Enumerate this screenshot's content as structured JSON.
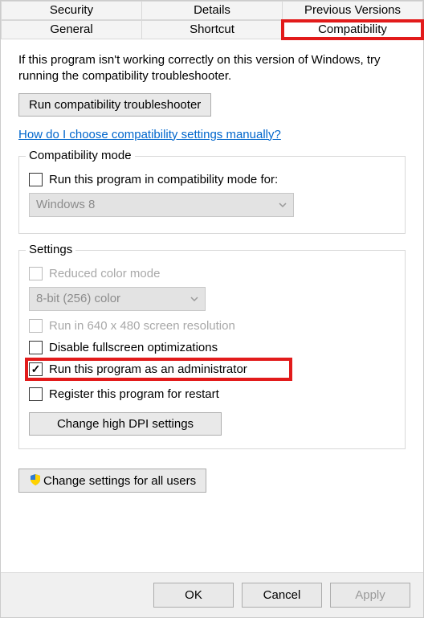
{
  "tabs": {
    "row1": [
      "Security",
      "Details",
      "Previous Versions"
    ],
    "row2": [
      "General",
      "Shortcut",
      "Compatibility"
    ]
  },
  "intro": "If this program isn't working correctly on this version of Windows, try running the compatibility troubleshooter.",
  "run_troubleshooter": "Run compatibility troubleshooter",
  "help_link": "How do I choose compatibility settings manually?",
  "compat_mode": {
    "title": "Compatibility mode",
    "checkbox": "Run this program in compatibility mode for:",
    "dropdown": "Windows 8"
  },
  "settings": {
    "title": "Settings",
    "reduced_color": "Reduced color mode",
    "color_dropdown": "8-bit (256) color",
    "run_640": "Run in 640 x 480 screen resolution",
    "disable_fullscreen": "Disable fullscreen optimizations",
    "run_admin": "Run this program as an administrator",
    "register_restart": "Register this program for restart",
    "change_dpi": "Change high DPI settings"
  },
  "change_all_users": "Change settings for all users",
  "footer": {
    "ok": "OK",
    "cancel": "Cancel",
    "apply": "Apply"
  }
}
